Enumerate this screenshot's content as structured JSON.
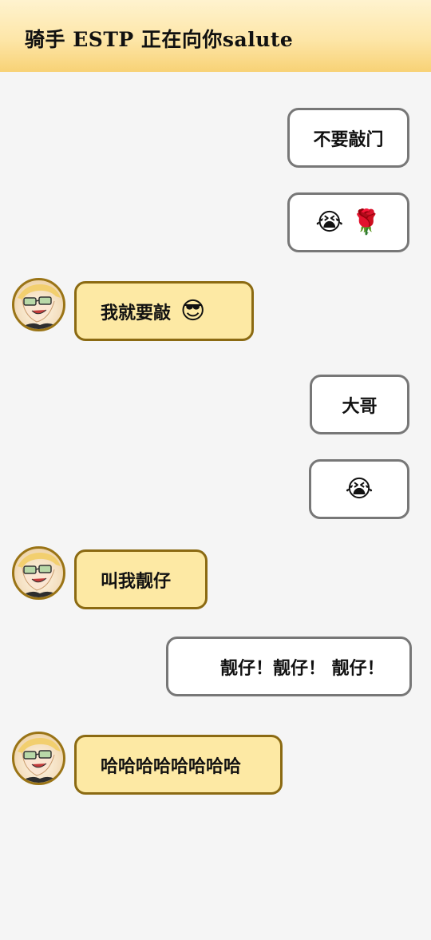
{
  "header": {
    "title": "骑手  ESTP 正在向你salute"
  },
  "messages": [
    {
      "side": "right",
      "text": "不要敲门"
    },
    {
      "side": "right",
      "text": "",
      "emojis": [
        "😭",
        "🌹"
      ]
    },
    {
      "side": "left",
      "text": "我就要敲",
      "emojis": [
        "😎"
      ]
    },
    {
      "side": "right",
      "text": "大哥"
    },
    {
      "side": "right",
      "text": "",
      "emojis": [
        "😭"
      ]
    },
    {
      "side": "left",
      "text": "叫我靓仔"
    },
    {
      "side": "right",
      "text": "靓仔！靓仔！  靓仔！"
    },
    {
      "side": "left",
      "text": "哈哈哈哈哈哈哈哈"
    }
  ],
  "colors": {
    "background": "#f5f5f5",
    "header_gradient_top": "#fff3cf",
    "header_gradient_bottom": "#f8d276",
    "left_bubble_fill": "#fde9a4",
    "left_bubble_border": "#8b6a12",
    "right_bubble_fill": "#ffffff",
    "right_bubble_border": "#777777"
  }
}
